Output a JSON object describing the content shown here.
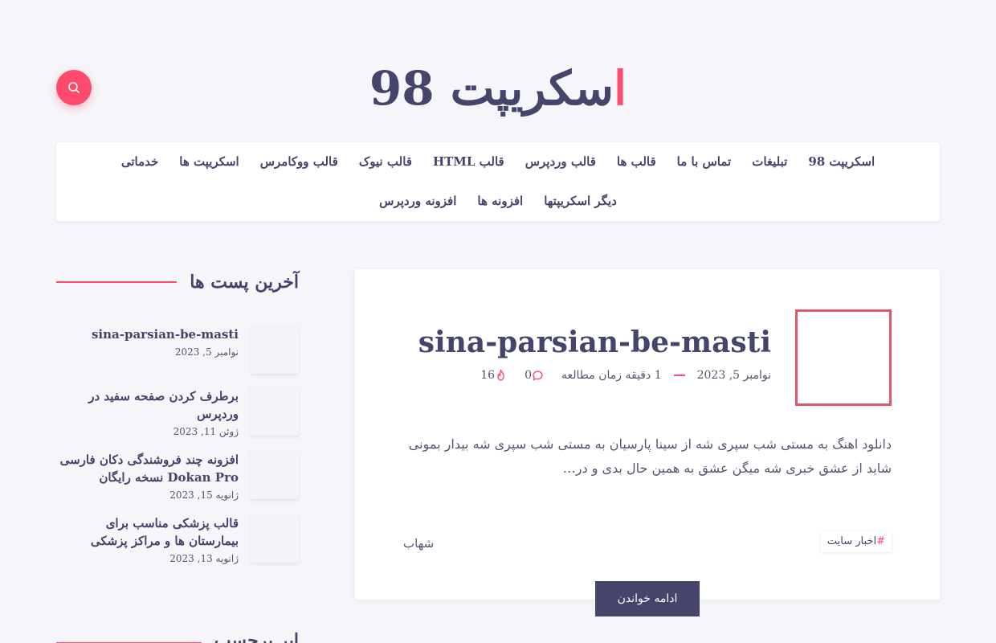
{
  "header": {
    "logo_accent": "ا",
    "logo_rest": "سکریپت 98"
  },
  "search": {
    "icon": "search-icon"
  },
  "nav": {
    "items": [
      "اسکریپت 98",
      "تبلیغات",
      "تماس با ما",
      "قالب ها",
      "قالب وردپرس",
      "قالب HTML",
      "قالب نیوک",
      "قالب ووکامرس",
      "اسکریپت ها",
      "خدماتی",
      "دیگر اسکریپتها",
      "افزونه ها",
      "افزونه وردپرس"
    ]
  },
  "sidebar": {
    "recent_title": "آخرین پست ها",
    "recent_posts": [
      {
        "title": "sina-parsian-be-masti",
        "date": "نوامبر 5, 2023"
      },
      {
        "title": "برطرف کردن صفحه سفید در وردپرس",
        "date": "ژوئن 11, 2023"
      },
      {
        "title": "افزونه چند فروشندگی دکان فارسی Dokan Pro نسخه رایگان",
        "date": "ژانویه 15, 2023"
      },
      {
        "title": "قالب پزشکی مناسب برای بیمارستان ها و مراکز پزشکی",
        "date": "ژانویه 13, 2023"
      }
    ],
    "second_title": "ابر برچسب"
  },
  "post": {
    "title": "sina-parsian-be-masti",
    "date": "نوامبر 5, 2023",
    "read_time": "1 دقیقه زمان مطالعه",
    "comments": "0",
    "views": "16",
    "excerpt": "دانلود اهنگ به مستی شب سپری شه از سینا پارسیان به مستی شب سپری شه بیدار بمونی شاید از عشق خبری شه میگن عشق به همین حال بدی و در…",
    "tag_hash": "#",
    "tag": "اخبار سایت",
    "author": "شهاب",
    "read_more": "ادامه خواندن"
  },
  "colors": {
    "accent": "#ff4a6b",
    "primary": "#45446b",
    "background": "#f5f5fa"
  }
}
